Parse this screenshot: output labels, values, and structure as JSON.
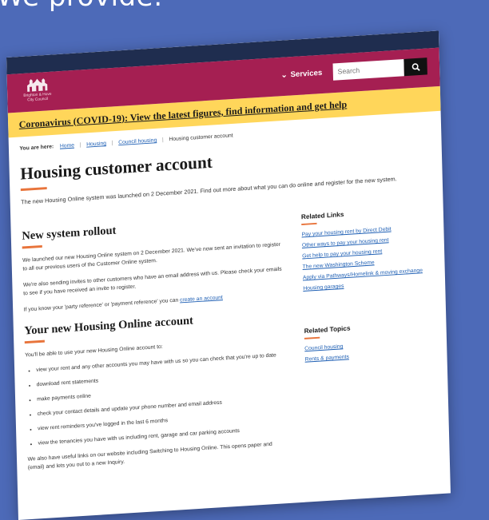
{
  "background_caption": "We provide:",
  "header": {
    "logo_lines": [
      "Brighton & Hove",
      "City Council"
    ],
    "services_label": "Services",
    "search_placeholder": "Search"
  },
  "alert": {
    "text": "Coronavirus (COVID-19): View the latest figures, find information and get help"
  },
  "breadcrumb": {
    "label": "You are here:",
    "items": [
      "Home",
      "Housing",
      "Council housing"
    ],
    "current": "Housing customer account"
  },
  "page": {
    "title": "Housing customer account",
    "intro": "The new Housing Online system was launched on 2 December 2021. Find out more about what you can do online and register for the new system."
  },
  "section1": {
    "heading": "New system rollout",
    "p1": "We launched our new Housing Online system on 2 December 2021. We've now sent an invitation to register to all our previous users of the Customer Online system.",
    "p2": "We're also sending invites to other customers who have an email address with us. Please check your emails to see if you have received an invite to register.",
    "p3_text": "If you know your 'party reference' or 'payment reference' you can",
    "p3_link": "create an account"
  },
  "section2": {
    "heading": "Your new Housing Online account",
    "lead": "You'll be able to use your new Housing Online account to:",
    "bullets": [
      "view your rent and any other accounts you may have with us so you can check that you're up to date",
      "download rent statements",
      "make payments online",
      "check your contact details and update your phone number and email address",
      "view rent reminders you've logged in the last 6 months",
      "view the tenancies you have with us including rent, garage and car parking accounts"
    ],
    "footer": "We also have useful links on our website including Switching to Housing Online. This opens paper and (email) and lets you out to a new Inquiry."
  },
  "related_links": {
    "heading": "Related Links",
    "items": [
      "Pay your housing rent by Direct Debit",
      "Other ways to pay your housing rent",
      "Get help to pay your housing rent",
      "The new Washington Scheme",
      "Apply via Pathways/Homelink & moving exchange",
      "Housing garages"
    ]
  },
  "related_topics": {
    "heading": "Related Topics",
    "items": [
      "Council housing",
      "Rents & payments"
    ]
  },
  "colors": {
    "header": "#a51f52",
    "alert": "#ffd65a",
    "accent": "#e8743b",
    "link": "#1e5fb4",
    "backdrop": "#4d6ab8"
  }
}
